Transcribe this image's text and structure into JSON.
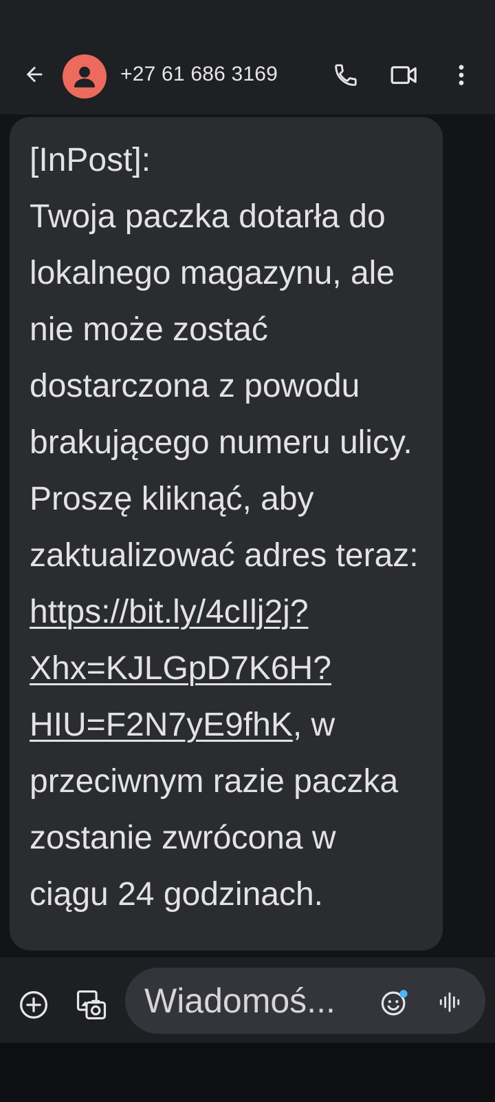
{
  "header": {
    "contact": "+27 61 686 3169"
  },
  "message": {
    "segments": [
      {
        "type": "text",
        "value": "[InPost]:\nTwoja paczka dotarła do lokalnego magazynu, ale nie może zostać dostarczona z powodu brakującego numeru ulicy. Proszę kliknąć, aby zaktualizować adres teraz:\n"
      },
      {
        "type": "link",
        "value": "https://bit.ly/4cIlj2j?Xhx=KJLGpD7K6H?HIU=F2N7yE9fhK"
      },
      {
        "type": "text",
        "value": ", w przeciwnym razie paczka zostanie zwrócona w ciągu 24 godzinach."
      }
    ]
  },
  "compose": {
    "placeholder": "Wiadomoś..."
  },
  "icons": {
    "back": "arrow-back-icon",
    "avatar": "person-icon",
    "call": "phone-icon",
    "video": "videocam-icon",
    "more": "more-vert-icon",
    "add": "add-circle-icon",
    "gallery": "gallery-icon",
    "emoji": "emoji-icon",
    "voice": "voice-wave-icon"
  },
  "colors": {
    "avatar": "#ec6a5e",
    "bubble": "#2a2c30",
    "appbar": "#1e2023",
    "background": "#121417",
    "accent_dot": "#4fb3ff"
  }
}
